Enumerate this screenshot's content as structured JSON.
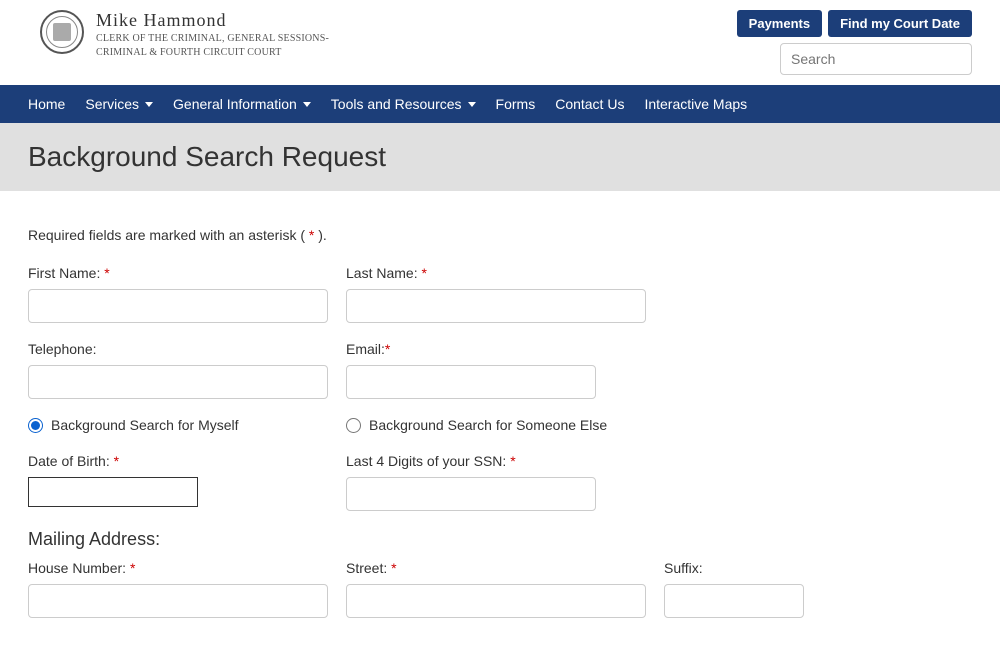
{
  "header": {
    "name": "Mike Hammond",
    "subtitle_line1": "CLERK OF THE CRIMINAL, GENERAL SESSIONS-",
    "subtitle_line2": "CRIMINAL & FOURTH CIRCUIT COURT",
    "payments_btn": "Payments",
    "court_date_btn": "Find my Court Date",
    "search_placeholder": "Search"
  },
  "nav": {
    "home": "Home",
    "services": "Services",
    "general_info": "General Information",
    "tools": "Tools and Resources",
    "forms": "Forms",
    "contact": "Contact Us",
    "maps": "Interactive Maps"
  },
  "page_title": "Background Search Request",
  "form": {
    "required_note_prefix": "Required fields are marked with an asterisk ( ",
    "required_note_suffix": " ).",
    "first_name_label": "First Name: ",
    "last_name_label": "Last Name: ",
    "telephone_label": "Telephone:",
    "email_label": "Email:",
    "radio_self": "Background Search for Myself",
    "radio_other": "Background Search for Someone Else",
    "dob_label": "Date of Birth: ",
    "ssn_label": "Last 4 Digits of your SSN: ",
    "mailing_heading": "Mailing Address:",
    "house_label": "House Number: ",
    "street_label": "Street: ",
    "suffix_label": "Suffix:"
  }
}
